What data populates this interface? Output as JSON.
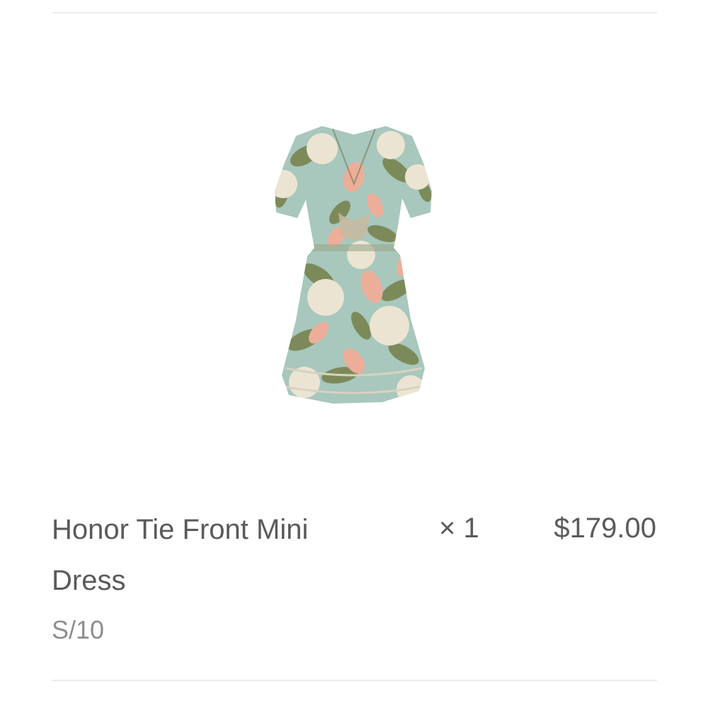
{
  "cart_item": {
    "name": "Honor Tie Front Mini Dress",
    "variant": "S/10",
    "quantity": "× 1",
    "price": "$179.00",
    "image": {
      "alt": "floral-mini-dress-product-image",
      "colors": {
        "base": "#a8c7bd",
        "cream": "#ece4d2",
        "leaf": "#7c8a5a",
        "peach": "#ecae98"
      }
    }
  }
}
